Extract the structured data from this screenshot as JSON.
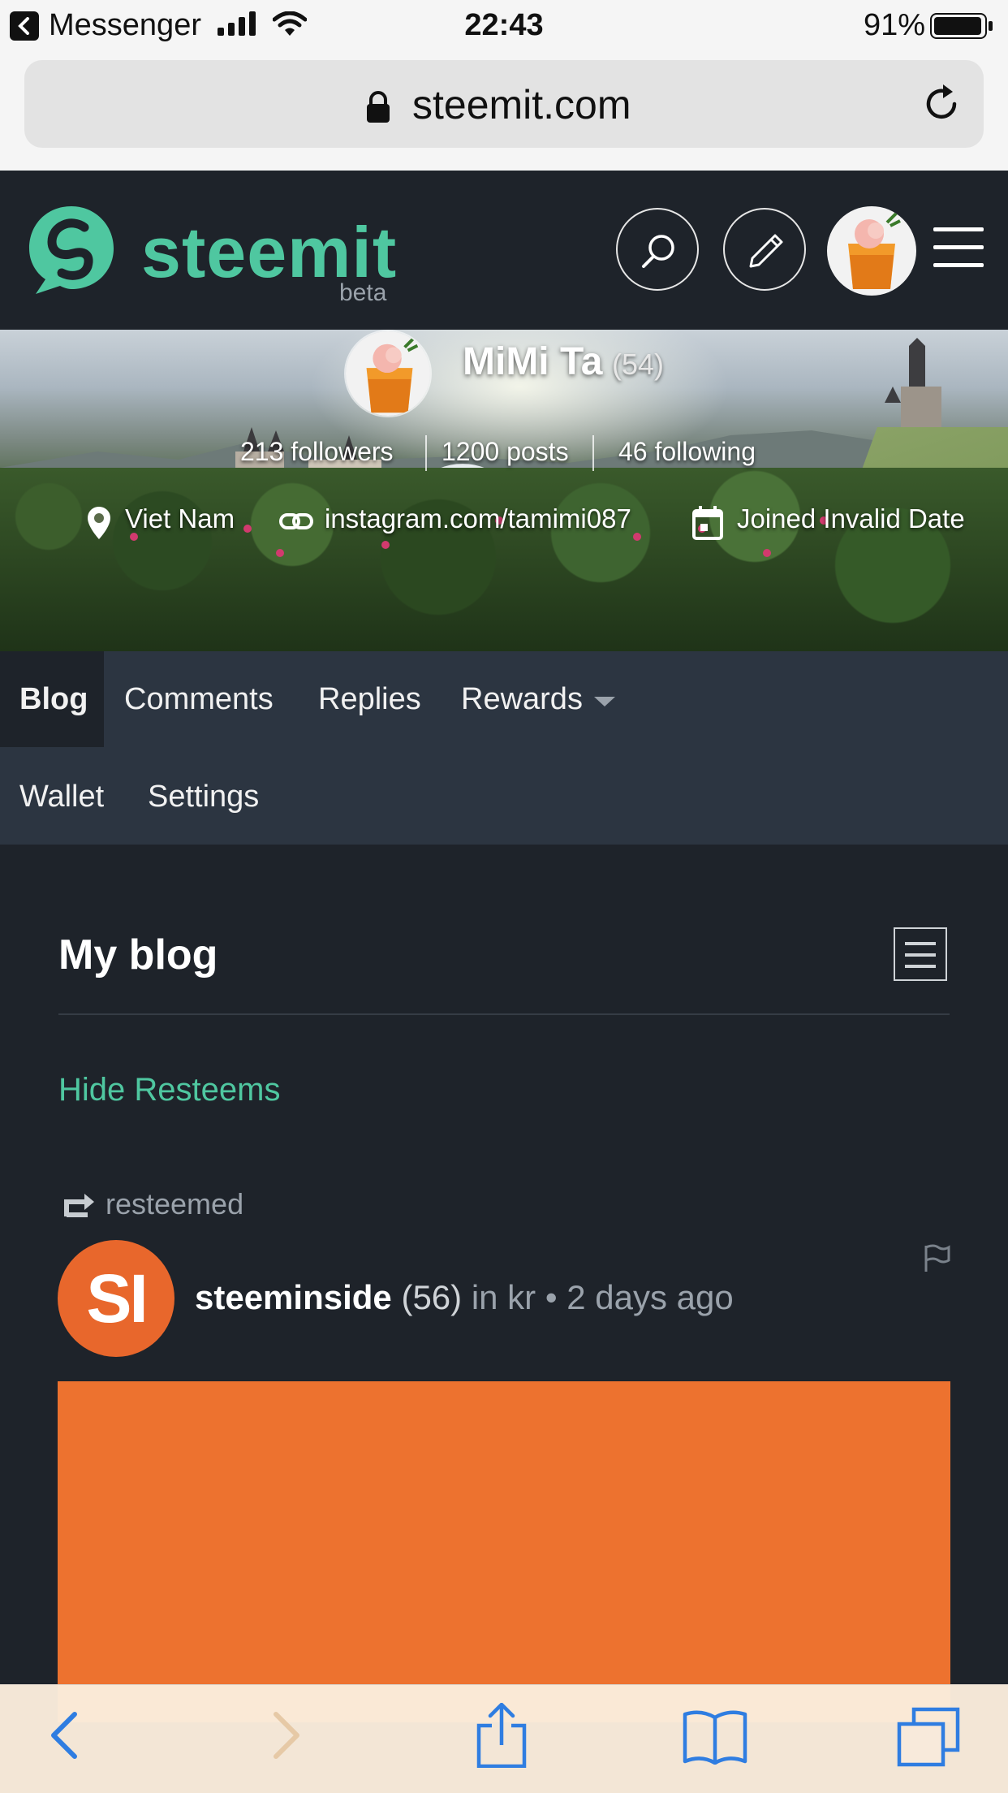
{
  "status_bar": {
    "back_app": "Messenger",
    "time": "22:43",
    "battery": "91%"
  },
  "browser": {
    "url": "steemit.com"
  },
  "header": {
    "logo_text": "steemit",
    "logo_sub": "beta"
  },
  "profile": {
    "name": "MiMi Ta",
    "reputation": "(54)",
    "followers": "213 followers",
    "posts": "1200 posts",
    "following": "46 following",
    "location": "Viet Nam",
    "website": "instagram.com/tamimi087",
    "joined": "Joined Invalid Date"
  },
  "tabs": {
    "blog": "Blog",
    "comments": "Comments",
    "replies": "Replies",
    "rewards": "Rewards",
    "wallet": "Wallet",
    "settings": "Settings"
  },
  "blog": {
    "title": "My blog",
    "hide_resteems": "Hide Resteems",
    "resteemed_label": "resteemed",
    "post": {
      "avatar_initials": "SI",
      "author": "steeminside",
      "author_rep": "(56)",
      "category": "in kr",
      "time": "• 2 days ago"
    }
  },
  "colors": {
    "steemit_green": "#4fc7a0",
    "header_bg": "#1e232a",
    "tab_bg": "#2c3541",
    "post_orange": "#ed722f"
  }
}
